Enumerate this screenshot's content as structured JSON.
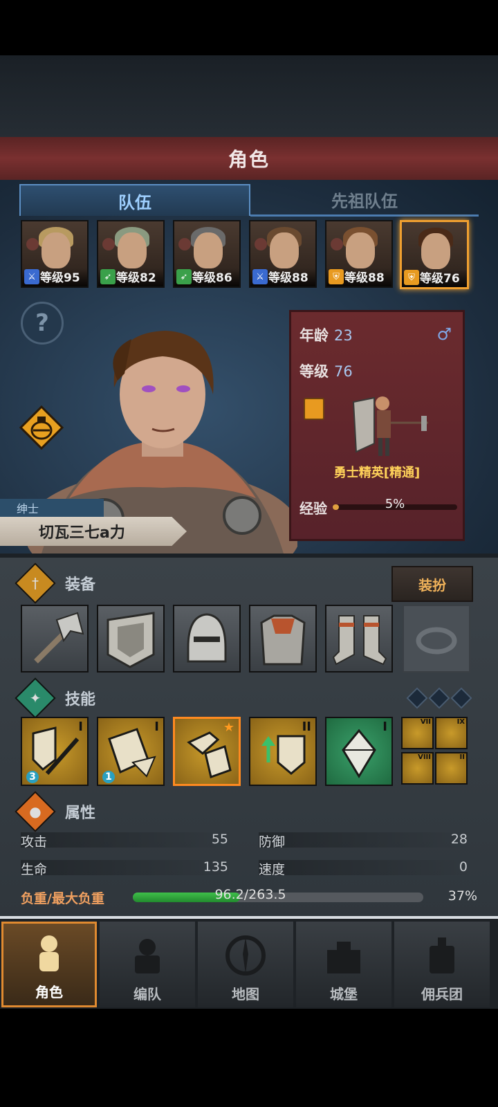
{
  "title": "角色",
  "tabs": [
    {
      "label": "队伍",
      "active": true
    },
    {
      "label": "先祖队伍",
      "active": false
    }
  ],
  "team": [
    {
      "level": "等级95",
      "role_icon": "sword-icon",
      "badge_color": "#3a6ad0",
      "hair": "#b89a60"
    },
    {
      "level": "等级82",
      "role_icon": "bow-icon",
      "badge_color": "#3aa04a",
      "hair": "#8a9a80"
    },
    {
      "level": "等级86",
      "role_icon": "bow-icon",
      "badge_color": "#3aa04a",
      "hair": "#6a6a6a"
    },
    {
      "level": "等级88",
      "role_icon": "sword-icon",
      "badge_color": "#3a6ad0",
      "hair": "#6a4a30"
    },
    {
      "level": "等级88",
      "role_icon": "shield-icon",
      "badge_color": "#e89a20",
      "hair": "#7a5030"
    },
    {
      "level": "等级76",
      "role_icon": "shield-icon",
      "badge_color": "#e89a20",
      "hair": "#4a2a18",
      "selected": true
    }
  ],
  "hero": {
    "title": "绅士",
    "name": "切瓦三七a力",
    "age_label": "年龄",
    "age": "23",
    "gender": "♂",
    "level_label": "等级",
    "level": "76",
    "class": "勇士精英[精通]",
    "exp_label": "经验",
    "exp_pct": "5%",
    "exp_fraction": 0.05
  },
  "equipment": {
    "label": "装备",
    "dress_button": "装扮",
    "slots": [
      "hammer-icon",
      "shield-icon",
      "helmet-icon",
      "armor-icon",
      "boots-icon",
      "ring-icon-empty"
    ]
  },
  "skills": {
    "label": "技能",
    "items": [
      {
        "icon": "shield-sword-skill-icon",
        "roman": "I",
        "count": "3"
      },
      {
        "icon": "shield-bash-skill-icon",
        "roman": "I",
        "count": "1"
      },
      {
        "icon": "charge-skill-icon",
        "roman": "★"
      },
      {
        "icon": "shield-up-skill-icon",
        "roman": "II"
      },
      {
        "icon": "crystal-skill-icon",
        "roman": "I"
      }
    ],
    "small": [
      "VII",
      "IX",
      "VIII",
      "II"
    ]
  },
  "attributes": {
    "label": "属性",
    "stats": [
      {
        "name": "攻击",
        "value": "55"
      },
      {
        "name": "防御",
        "value": "28"
      },
      {
        "name": "生命",
        "value": "135"
      },
      {
        "name": "速度",
        "value": "0"
      }
    ],
    "load_label": "负重/最大负重",
    "load_value": "96.2/263.5",
    "load_pct": "37%",
    "load_fraction": 0.37
  },
  "nav": [
    {
      "label": "角色",
      "icon": "knight-icon",
      "active": true
    },
    {
      "label": "编队",
      "icon": "formation-icon"
    },
    {
      "label": "地图",
      "icon": "compass-icon"
    },
    {
      "label": "城堡",
      "icon": "castle-icon"
    },
    {
      "label": "佣兵团",
      "icon": "mercenary-icon"
    }
  ]
}
